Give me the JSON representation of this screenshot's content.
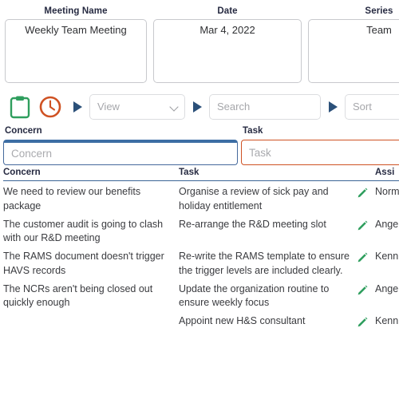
{
  "summary": {
    "cards": [
      {
        "label": "Meeting Name",
        "value": "Weekly Team Meeting"
      },
      {
        "label": "Date",
        "value": "Mar 4, 2022"
      },
      {
        "label": "Series",
        "value": "Team"
      }
    ]
  },
  "toolbar": {
    "clipboard_icon": "clipboard-icon",
    "clock_icon": "clock-icon",
    "view_placeholder": "View",
    "search_placeholder": "Search",
    "sort_placeholder": "Sort",
    "arrow_icon": "play-triangle-icon",
    "chevron_icon": "chevron-down-icon"
  },
  "entry": {
    "concern_label": "Concern",
    "concern_placeholder": "Concern",
    "task_label": "Task",
    "task_placeholder": "Task"
  },
  "table": {
    "headers": {
      "concern": "Concern",
      "task": "Task",
      "assignee": "Assi"
    },
    "rows": [
      {
        "concern": "We need to review our benefits package",
        "task": "Organise a review of sick pay and holiday entitlement",
        "edit_icon": "pencil-icon",
        "assignee": "Norm"
      },
      {
        "concern": "The customer audit is going to clash with our R&D meeting",
        "task": "Re-arrange the R&D meeting slot",
        "edit_icon": "pencil-icon",
        "assignee": "Ange"
      },
      {
        "concern": "The RAMS document doesn't trigger HAVS records",
        "task": "Re-write the RAMS template to ensure the trigger levels are included clearly.",
        "edit_icon": "pencil-icon",
        "assignee": "Kenn"
      },
      {
        "concern": "The NCRs aren't being closed out quickly enough",
        "task": "Update the organization routine to ensure weekly focus",
        "edit_icon": "pencil-icon",
        "assignee": "Ange"
      },
      {
        "concern": "",
        "task": "Appoint new H&S consultant",
        "edit_icon": "pencil-icon",
        "assignee": "Kenn"
      }
    ]
  },
  "colors": {
    "clipboard_green": "#2f9e5e",
    "clock_orange": "#cf5223",
    "arrow_blue": "#2b5079",
    "concern_border": "#45699c",
    "task_border": "#cf5223",
    "header_rule": "#3a6495",
    "pencil_green": "#2f9e5e"
  }
}
